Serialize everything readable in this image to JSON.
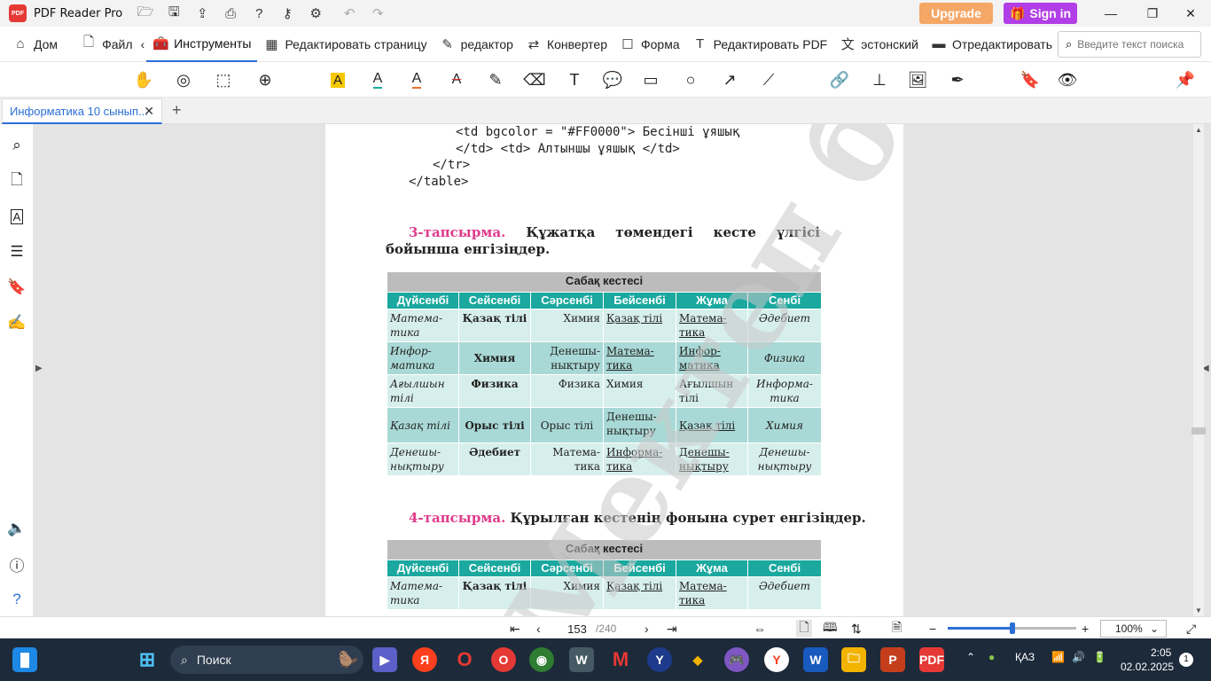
{
  "app": {
    "name": "PDF Reader Pro",
    "logo": "PDF"
  },
  "titlebar": {
    "upgrade_label": "Upgrade",
    "signin_label": "Sign in",
    "accent_upgrade": "#f5a766",
    "accent_signin": "#b13ee6"
  },
  "menu": {
    "items": [
      {
        "label": "Дом",
        "icon": "home-icon"
      },
      {
        "label": "Файл",
        "icon": "file-icon"
      },
      {
        "label": "Инструменты",
        "icon": "toolbox-icon",
        "active": true
      },
      {
        "label": "Редактировать страницу",
        "icon": "grid-icon"
      },
      {
        "label": "редактор",
        "icon": "edit-icon"
      },
      {
        "label": "Конвертер",
        "icon": "convert-icon"
      },
      {
        "label": "Форма",
        "icon": "form-icon"
      },
      {
        "label": "Редактировать PDF",
        "icon": "text-edit-icon"
      },
      {
        "label": "эстонский",
        "icon": "translate-icon"
      },
      {
        "label": "Отредактировать",
        "icon": "redact-icon"
      }
    ],
    "search_placeholder": "Введите текст поиска"
  },
  "tab": {
    "title": "Информатика 10 сынып..."
  },
  "document": {
    "code_lines": [
      "<td bgcolor = \"#FF0000\"> Бесінші ұяшық",
      "</td> <td> Алтыншы ұяшық </td>",
      "</tr>",
      "</table>"
    ],
    "task3": {
      "num": "3-тапсырма.",
      "text": "Құжатқа төмендегі кесте үлгісі бойынша енгізіңдер."
    },
    "task4": {
      "num": "4-тапсырма.",
      "text": "Құрылған кестенің фонына сурет енгізіңдер."
    },
    "table_caption": "Сабақ кестесі",
    "days": [
      "Дүйсенбі",
      "Сейсенбі",
      "Сәрсенбі",
      "Бейсенбі",
      "Жұма",
      "Сенбі"
    ],
    "rows": [
      [
        "Матема-тика",
        "Қазақ тілі",
        "Химия",
        "Қазақ тілі",
        "Матема-тика",
        "Әдебиет"
      ],
      [
        "Инфор-матика",
        "Химия",
        "Денешы-нықтыру",
        "Матема-тика",
        "Инфор-матика",
        "Физика"
      ],
      [
        "Ағылшын тілі",
        "Физика",
        "Физика",
        "Химия",
        "Ағылшын тілі",
        "Информа-тика"
      ],
      [
        "Қазақ тілі",
        "Орыс тілі",
        "Орыс тілі",
        "Денешы-нықтыру",
        "Қазақ тілі",
        "Химия"
      ],
      [
        "Денешы-нықтыру",
        "Әдебиет",
        "Матема-тика",
        "Информа-тика",
        "Денешы-нықтыру",
        "Денешы-нықтыру"
      ]
    ],
    "watermark": "Мектеп баспасы"
  },
  "status": {
    "page": "153",
    "total": "/240",
    "zoom": "100%",
    "zoom_level": 0.5
  },
  "taskbar": {
    "search_label": "Поиск",
    "lang": "ҚАЗ",
    "time": "2:05",
    "date": "02.02.2025",
    "notifications": "1"
  }
}
